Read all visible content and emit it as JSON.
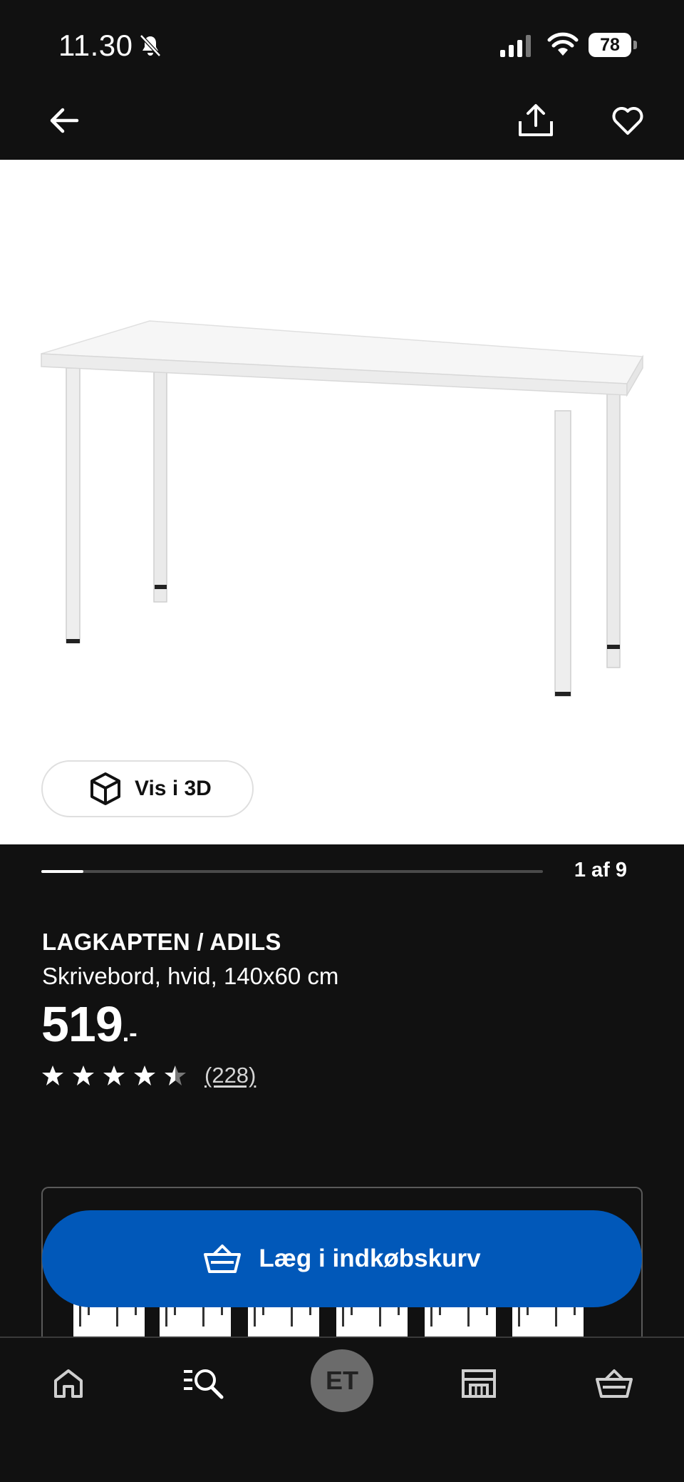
{
  "status_bar": {
    "time": "11.30",
    "battery_level": "78",
    "icons": [
      "bell-muted-icon",
      "signal-icon",
      "wifi-icon",
      "battery-icon"
    ]
  },
  "top_nav": {
    "icons": [
      "back-arrow-icon",
      "share-icon",
      "heart-icon"
    ]
  },
  "hero": {
    "view_3d_label": "Vis i 3D",
    "view_3d_icon": "cube-icon"
  },
  "gallery": {
    "counter": "1 af 9",
    "progress": 0.0833
  },
  "product": {
    "name": "LAGKAPTEN / ADILS",
    "description": "Skrivebord, hvid, 140x60 cm",
    "price": "519",
    "price_suffix": ".-",
    "rating": 4.5,
    "rating_max": 5,
    "reviews": "(228)"
  },
  "cart_button": {
    "label": "Læg i indkøbskurv",
    "icon": "basket-icon",
    "color": "#0158b9"
  },
  "tab_bar": {
    "avatar_initials": "ET",
    "items": [
      "home-icon",
      "search-list-icon",
      "avatar",
      "store-icon",
      "basket-icon"
    ]
  },
  "colors": {
    "background": "#111111",
    "accent": "#0158b9",
    "hero_background": "#ffffff"
  }
}
